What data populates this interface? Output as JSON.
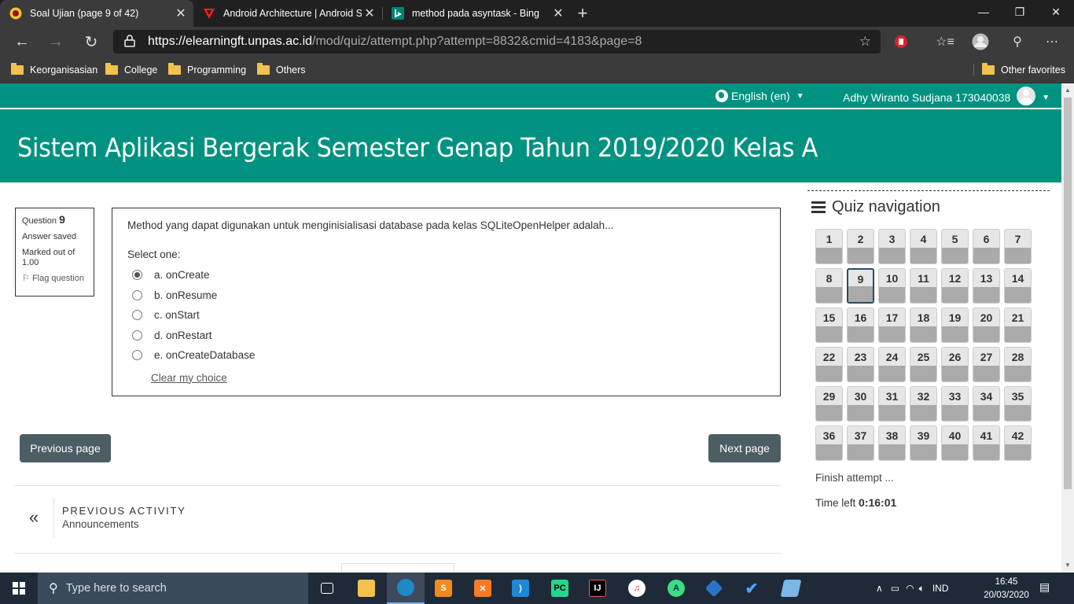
{
  "browser": {
    "tabs": [
      {
        "title": "Soal Ujian (page 9 of 42)",
        "active": true
      },
      {
        "title": "Android Architecture | Android S",
        "active": false
      },
      {
        "title": "method pada asyntask - Bing",
        "active": false
      }
    ],
    "url_host": "https://elearningft.unpas.ac.id",
    "url_path": "/mod/quiz/attempt.php?attempt=8832&cmid=4183&page=8",
    "favorites": [
      "Keorganisasian",
      "College",
      "Programming",
      "Others"
    ],
    "other_favorites": "Other favorites"
  },
  "site": {
    "language": "English (en)",
    "user_name": "Adhy Wiranto Sudjana 173040038",
    "course_title": "Sistem Aplikasi Bergerak Semester Genap Tahun 2019/2020 Kelas A"
  },
  "question_info": {
    "label": "Question",
    "number": "9",
    "status": "Answer saved",
    "marks": "Marked out of 1.00",
    "flag": "Flag question"
  },
  "question": {
    "text": "Method yang dapat digunakan untuk menginisialisasi database pada kelas SQLiteOpenHelper adalah...",
    "select_label": "Select one:",
    "options": [
      {
        "label": "a. onCreate",
        "selected": true
      },
      {
        "label": "b. onResume",
        "selected": false
      },
      {
        "label": "c. onStart",
        "selected": false
      },
      {
        "label": "d. onRestart",
        "selected": false
      },
      {
        "label": "e. onCreateDatabase",
        "selected": false
      }
    ],
    "clear_label": "Clear my choice"
  },
  "navigation": {
    "previous_page": "Previous page",
    "next_page": "Next page",
    "previous_activity_label": "PREVIOUS ACTIVITY",
    "previous_activity_name": "Announcements"
  },
  "quiz_nav": {
    "title": "Quiz navigation",
    "total_questions": 42,
    "current": 9,
    "finish_label": "Finish attempt ...",
    "time_left_label": "Time left",
    "time_left_value": "0:16:01"
  },
  "taskbar": {
    "search_placeholder": "Type here to search",
    "language": "IND",
    "time": "16:45",
    "date": "20/03/2020"
  },
  "colors": {
    "header_teal": "#009281",
    "button_slate": "#4d5d64",
    "current_border": "#2d4d5f"
  }
}
